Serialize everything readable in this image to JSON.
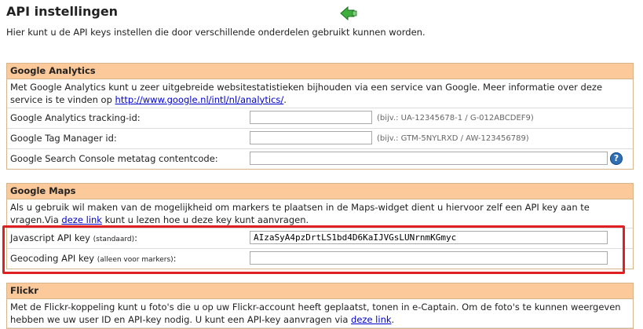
{
  "header": {
    "title": "API instellingen",
    "subtitle": "Hier kunt u de API keys instellen die door verschillende onderdelen gebruikt kunnen worden."
  },
  "google_analytics": {
    "heading": "Google Analytics",
    "description": "Met Google Analytics kunt u zeer uitgebreide websitestatistieken bijhouden via een service van Google. Meer informatie over deze service is te vinden op",
    "link": "http://www.google.nl/intl/nl/analytics/",
    "description_end": ".",
    "fields": [
      {
        "label": "Google Analytics tracking-id:",
        "value": "",
        "hint": "(bijv.: UA-12345678-1 / G-012ABCDEF9)"
      },
      {
        "label": "Google Tag Manager id:",
        "value": "",
        "hint": "(bijv.: GTM-5NYLRXD / AW-123456789)"
      },
      {
        "label": "Google Search Console metatag contentcode:",
        "value": ""
      }
    ],
    "help_glyph": "?"
  },
  "google_maps": {
    "heading": "Google Maps",
    "description_start": "Als u gebruik wil maken van de mogelijkheid om markers te plaatsen in de Maps-widget dient u hiervoor zelf een API key aan te vragen.Via",
    "link": "deze link",
    "description_end": "kunt u lezen hoe u deze key kunt aanvragen.",
    "fields": [
      {
        "label": "Javascript API key",
        "note": "(standaard)",
        "suffix": ":",
        "value": "AIzaSyA4pzDrtLS1bd4D6KaIJVGsLUNrnmKGmyc"
      },
      {
        "label": "Geocoding API key",
        "note": "(alleen voor markers)",
        "suffix": ":",
        "value": ""
      }
    ]
  },
  "flickr": {
    "heading": "Flickr",
    "description_start": "Met de Flickr-koppeling kunt u foto's die u op uw Flickr-account heeft geplaatst, tonen in e-Captain. Om de foto's te kunnen weergeven hebben we uw user ID en API-key nodig. U kunt een API-key aanvragen via",
    "link": "deze link",
    "description_end": "."
  },
  "colors": {
    "section_header": "#fcc99a",
    "highlight": "#e02020",
    "link": "#0000cc"
  }
}
